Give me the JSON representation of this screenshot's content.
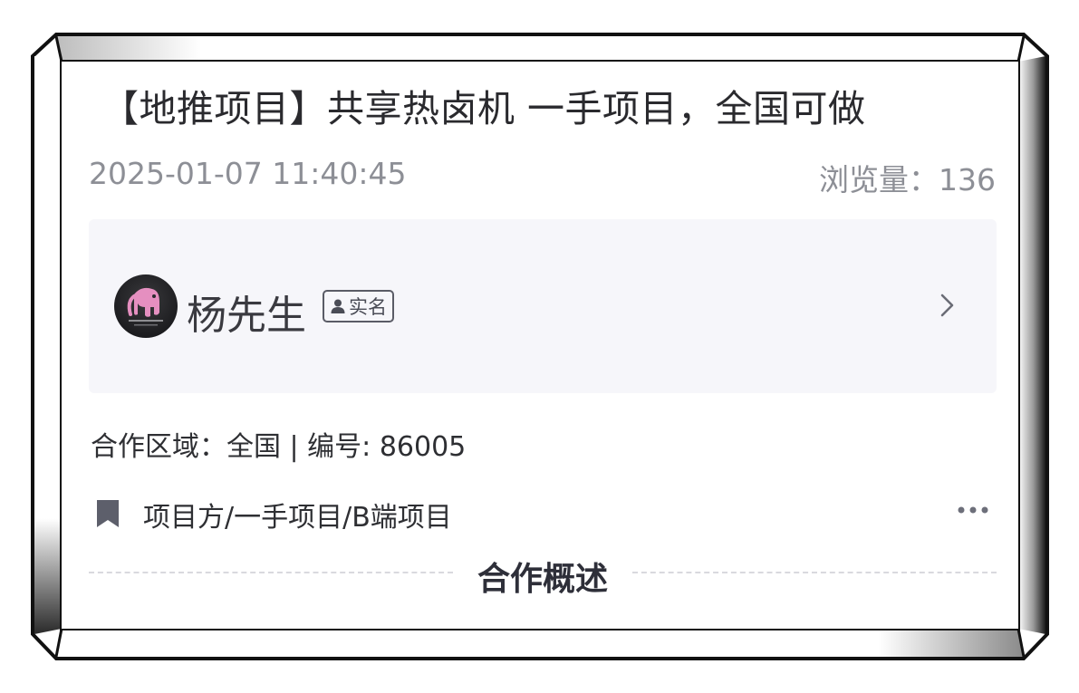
{
  "post": {
    "title": "【地推项目】共享热卤机 一手项目，全国可做",
    "date": "2025-01-07 11:40:45",
    "views": "浏览量：136"
  },
  "publisher": {
    "name": "杨先生",
    "badge": "实名",
    "avatar_icon": "elephant-logo"
  },
  "details": {
    "region_line": "合作区域：全国 | 编号: 86005",
    "tags": "项目方/一手项目/B端项目",
    "section_title": "合作概述"
  },
  "colors": {
    "panel_bg": "#f6f6fa",
    "muted_text": "#8d8f96",
    "frame": "#111111"
  }
}
